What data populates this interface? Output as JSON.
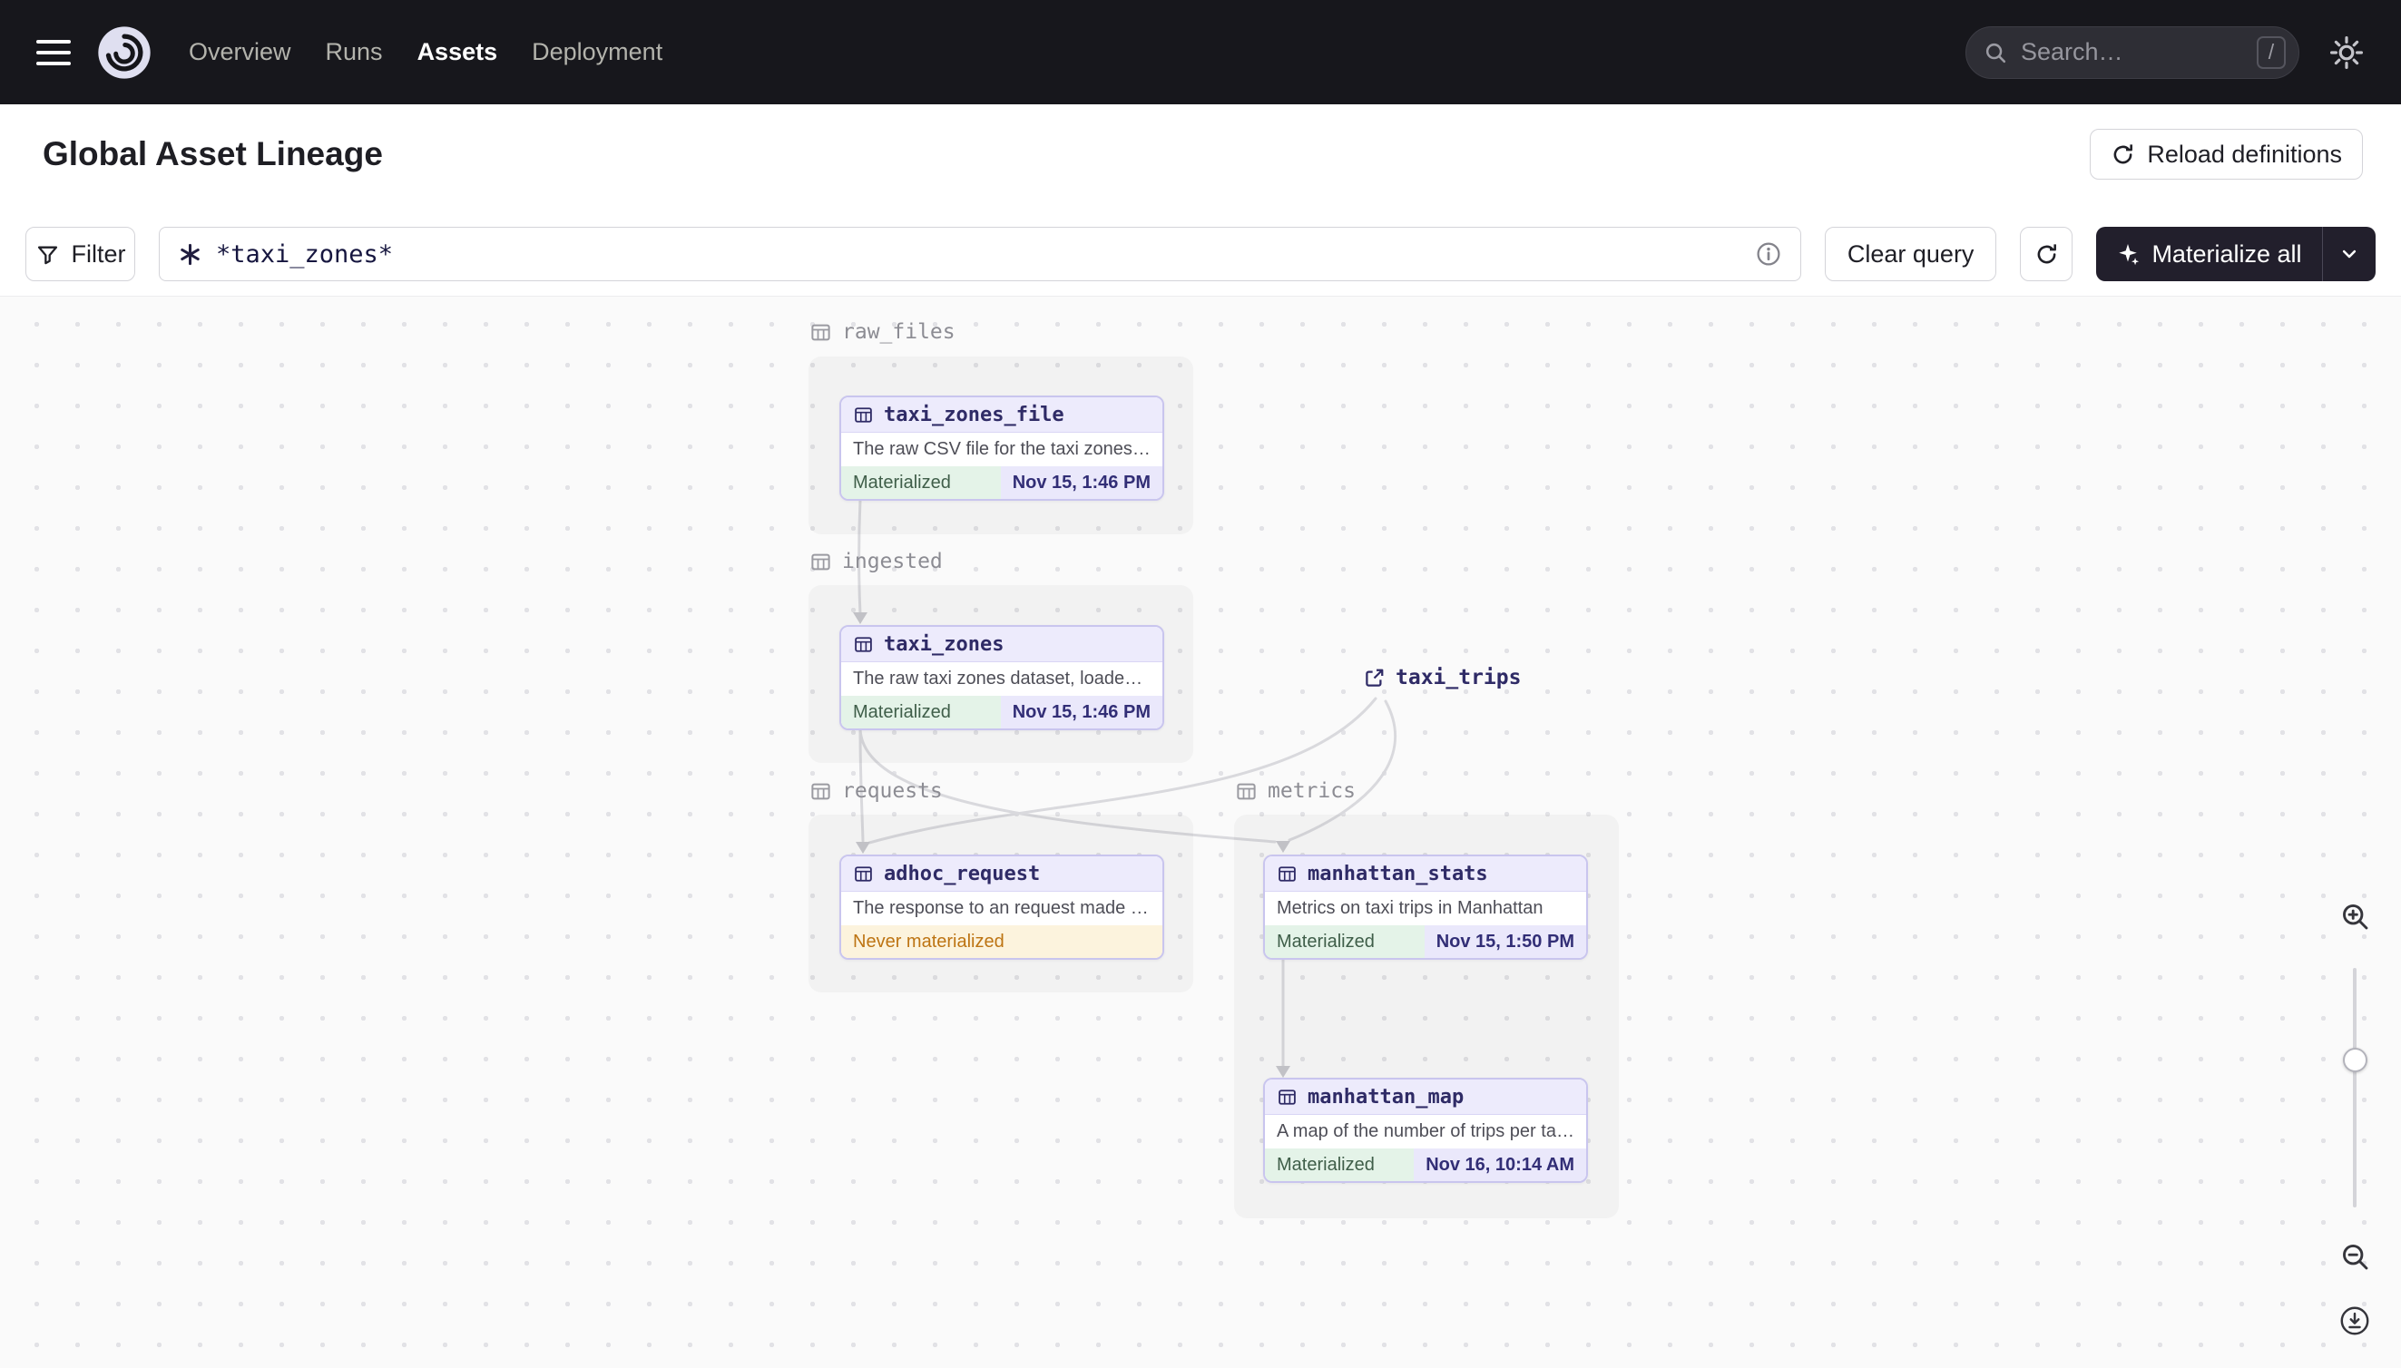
{
  "navbar": {
    "items": [
      {
        "label": "Overview"
      },
      {
        "label": "Runs"
      },
      {
        "label": "Assets"
      },
      {
        "label": "Deployment"
      }
    ],
    "active_item": "Assets",
    "search_placeholder": "Search…",
    "search_shortcut": "/"
  },
  "header": {
    "title": "Global Asset Lineage",
    "reload_button": "Reload definitions"
  },
  "toolbar": {
    "filter_button": "Filter",
    "query_value": "*taxi_zones*",
    "clear_button": "Clear query",
    "materialize_button": "Materialize all"
  },
  "graph": {
    "groups": [
      {
        "label": "raw_files"
      },
      {
        "label": "ingested"
      },
      {
        "label": "requests"
      },
      {
        "label": "metrics"
      }
    ],
    "external_assets": [
      {
        "name": "taxi_trips"
      }
    ],
    "nodes": [
      {
        "name": "taxi_zones_file",
        "group": "raw_files",
        "description": "The raw CSV file for the taxi zones dat...",
        "status": "Materialized",
        "timestamp": "Nov 15, 1:46 PM"
      },
      {
        "name": "taxi_zones",
        "group": "ingested",
        "description": "The raw taxi zones dataset, loaded int...",
        "status": "Materialized",
        "timestamp": "Nov 15, 1:46 PM"
      },
      {
        "name": "adhoc_request",
        "group": "requests",
        "description": "The response to an request made in th...",
        "status": "Never materialized"
      },
      {
        "name": "manhattan_stats",
        "group": "metrics",
        "description": "Metrics on taxi trips in Manhattan",
        "status": "Materialized",
        "timestamp": "Nov 15, 1:50 PM"
      },
      {
        "name": "manhattan_map",
        "group": "metrics",
        "description": "A map of the number of trips per taxi z...",
        "status": "Materialized",
        "timestamp": "Nov 16, 10:14 AM"
      }
    ],
    "edges": [
      {
        "from": "taxi_zones_file",
        "to": "taxi_zones"
      },
      {
        "from": "taxi_zones",
        "to": "adhoc_request"
      },
      {
        "from": "taxi_zones",
        "to": "manhattan_stats"
      },
      {
        "from": "taxi_trips",
        "to": "adhoc_request"
      },
      {
        "from": "taxi_trips",
        "to": "manhattan_stats"
      },
      {
        "from": "manhattan_stats",
        "to": "manhattan_map"
      }
    ]
  },
  "colors": {
    "navbar_bg": "#17171c",
    "canvas_bg": "#fafafa",
    "node_border": "#c9c5ee",
    "node_header_bg": "#edebfc",
    "asset_name_text": "#2f2b66",
    "materialized_bg": "#e4f3e8",
    "materialized_text": "#3f5e49",
    "timestamp_bg": "#eae8fb",
    "timestamp_text": "#322e76",
    "never_materialized_bg": "#fcf3dd",
    "never_materialized_text": "#bd7413",
    "dark_button_bg": "#221f2c"
  },
  "icons": {
    "settings": "gear-icon",
    "search": "magnifier-icon",
    "zoom_in": "magnifier-plus-icon",
    "zoom_out": "magnifier-minus-icon",
    "download": "download-circle-icon"
  }
}
